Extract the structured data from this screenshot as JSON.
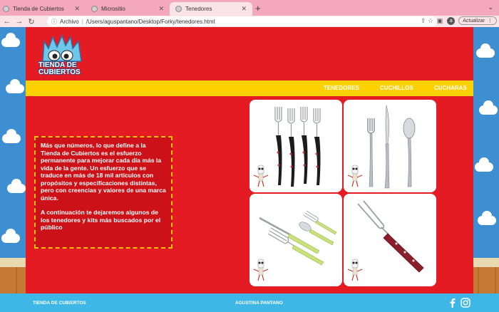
{
  "browser": {
    "tabs": [
      {
        "label": "Tienda de Cubiertos",
        "active": false
      },
      {
        "label": "Micrositio",
        "active": false
      },
      {
        "label": "Tenedores",
        "active": true
      }
    ],
    "address_prefix": "Archivo",
    "address": "/Users/aguspantano/Desktop/Forky/tenedores.html",
    "profile_initial": "a",
    "update_label": "Actualizar"
  },
  "site": {
    "logo_line1": "TIENDA DE",
    "logo_line2": "CUBIERTOS",
    "nav": [
      "TENEDORES",
      "CUCHILLOS",
      "CUCHARAS"
    ],
    "intro_paragraph": "Más que números, lo que define a la Tienda de Cubiertos es el esfuerzo permanente para mejorar cada día más la vida de la gente. Un esfuerzo que se traduce en más de 18 mil artículos con propósitos y especificaciones distintas, pero con creencias y valores de una marca única.",
    "secondary_paragraph": "A continuación te dejaremos algunos de los tenedores y kits más buscados por el público",
    "footer_left": "TIENDA DE CUBIERTOS",
    "footer_center": "AGUSTINA PANTANO"
  },
  "colors": {
    "site_red": "#e41b23",
    "nav_yellow": "#fdd000",
    "footer_blue": "#3fb7e6",
    "sky_blue": "#3d8fd2"
  }
}
